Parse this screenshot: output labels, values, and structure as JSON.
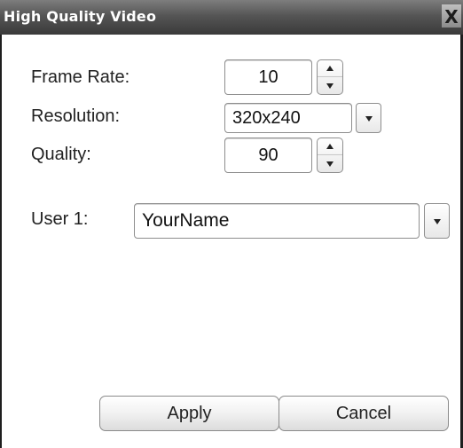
{
  "window": {
    "title": "High Quality Video",
    "close_label": "X"
  },
  "settings": {
    "frame_rate": {
      "label": "Frame Rate:",
      "value": "10"
    },
    "resolution": {
      "label": "Resolution:",
      "value": "320x240"
    },
    "quality": {
      "label": "Quality:",
      "value": "90"
    }
  },
  "user": {
    "label": "User 1:",
    "value": "YourName"
  },
  "buttons": {
    "apply": "Apply",
    "cancel": "Cancel"
  }
}
